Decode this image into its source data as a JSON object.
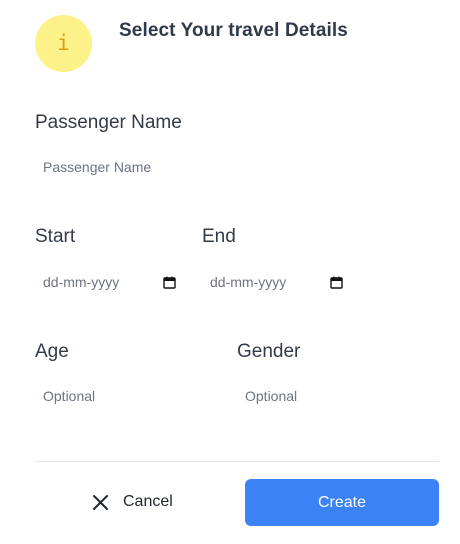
{
  "dialog": {
    "title": "Select Your travel Details",
    "icon": "info-icon",
    "icon_glyph": "i",
    "accent_color": "#fdf18a"
  },
  "fields": {
    "passenger_name": {
      "label": "Passenger Name",
      "placeholder": "Passenger Name",
      "value": ""
    },
    "start": {
      "label": "Start",
      "placeholder": "dd-mm-yyyy",
      "icon": "calendar-icon"
    },
    "end": {
      "label": "End",
      "placeholder": "dd-mm-yyyy",
      "icon": "calendar-icon"
    },
    "age": {
      "label": "Age",
      "placeholder": "Optional"
    },
    "gender": {
      "label": "Gender",
      "placeholder": "Optional"
    }
  },
  "footer": {
    "cancel_label": "Cancel",
    "cancel_icon": "close-icon",
    "create_label": "Create",
    "create_color": "#3b82f6"
  }
}
